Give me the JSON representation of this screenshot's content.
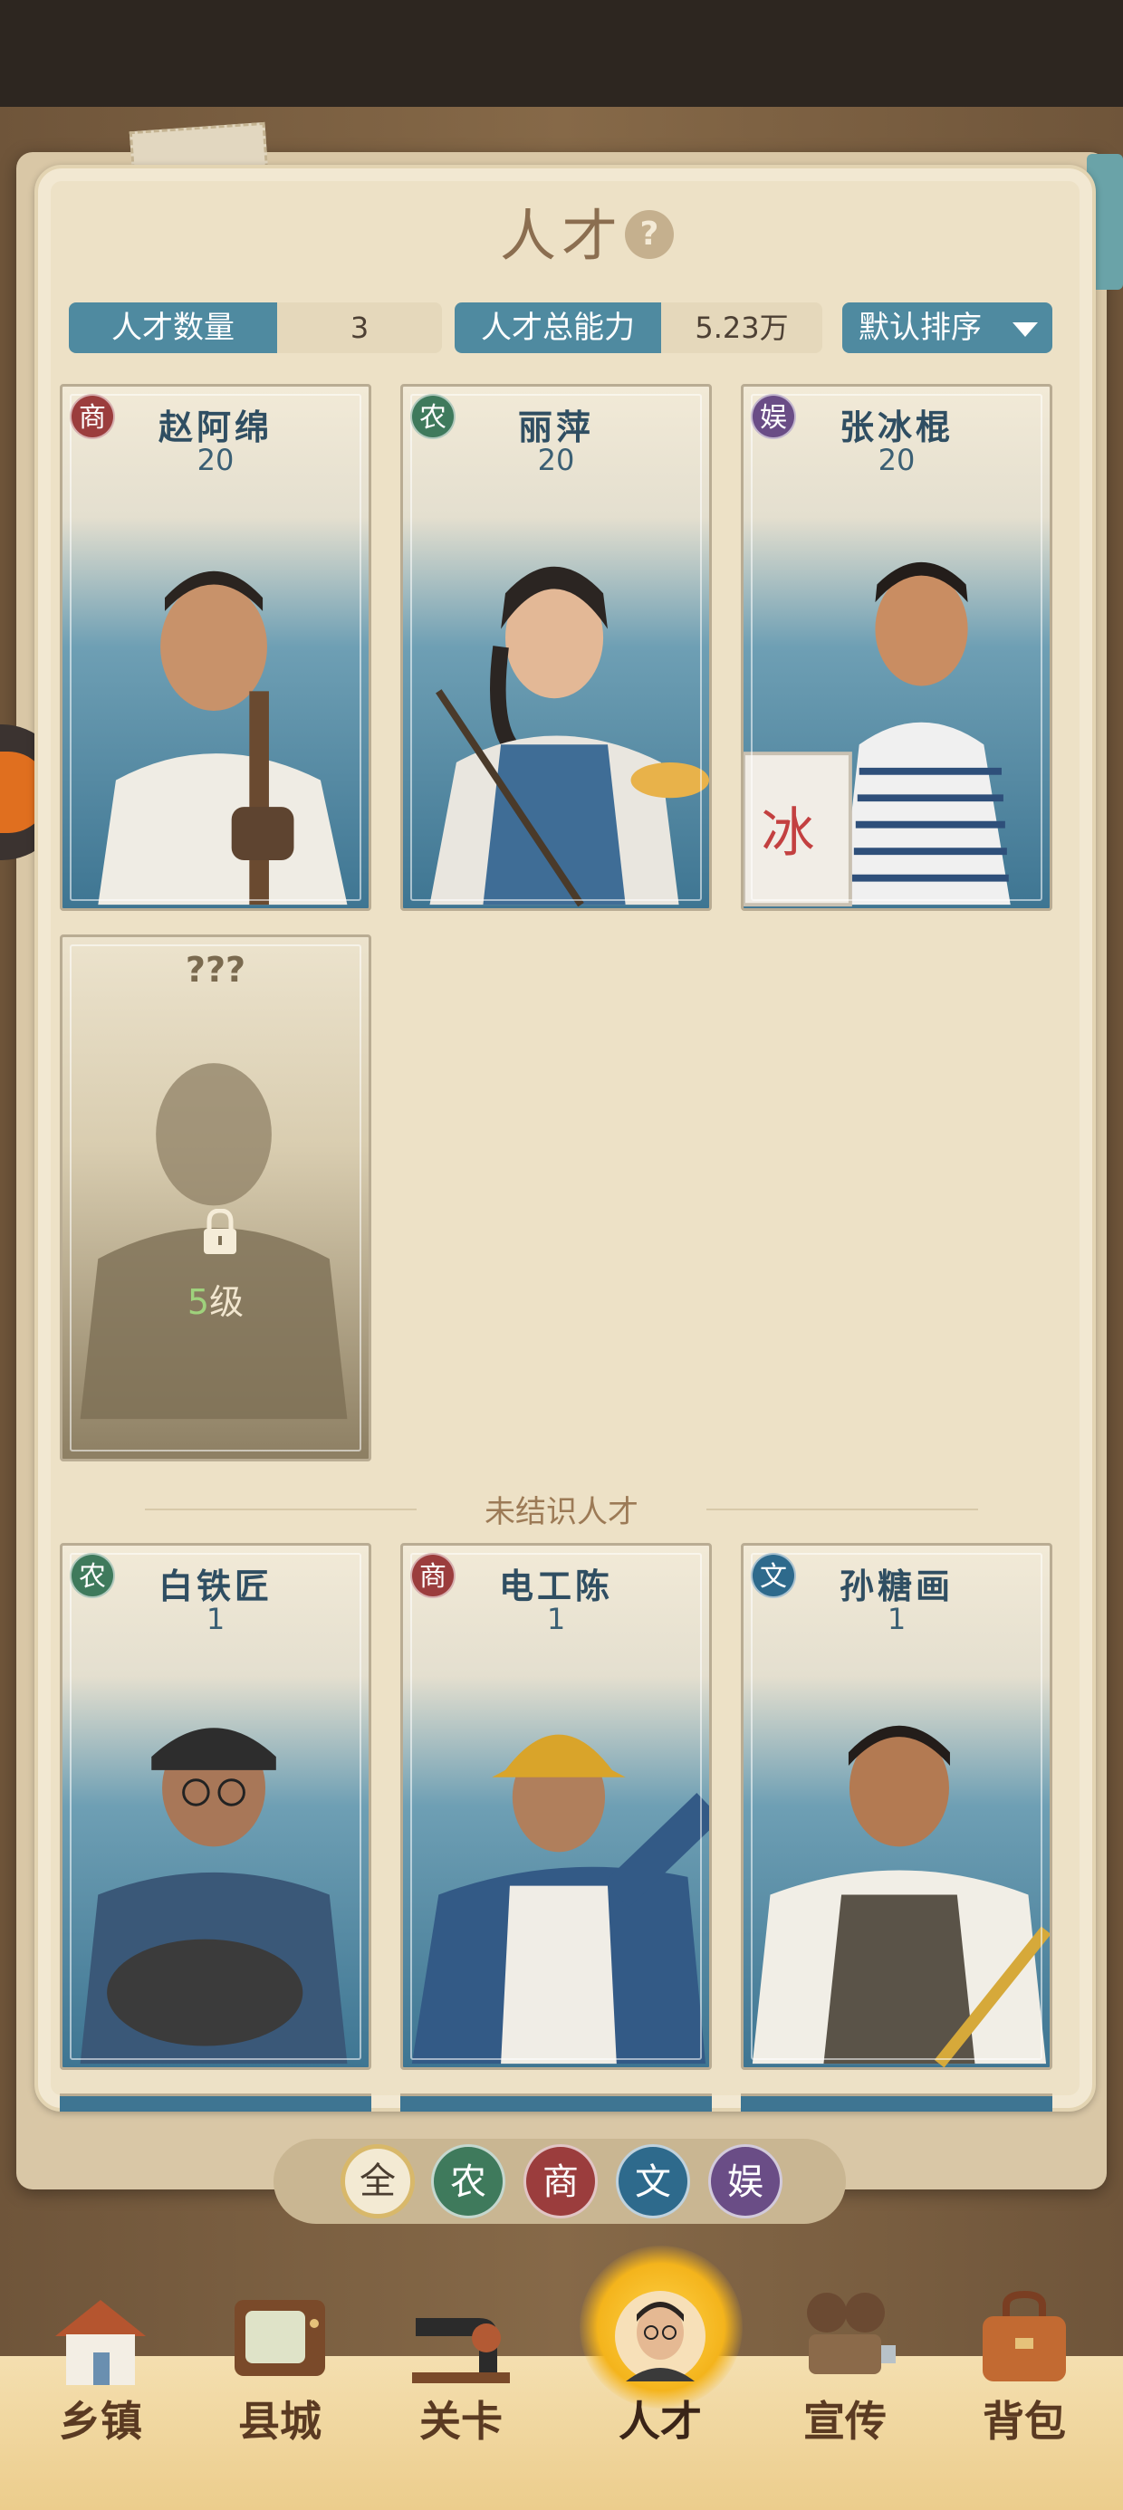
{
  "header": {
    "title": "人才",
    "help_glyph": "?"
  },
  "stats": {
    "count_label": "人才数量",
    "count_value": "3",
    "power_label": "人才总能力",
    "power_value": "5.23万",
    "sort_label": "默认排序"
  },
  "known_talents": [
    {
      "name": "赵阿绵",
      "level": "20",
      "category": "商",
      "category_color": "#9b3d3d"
    },
    {
      "name": "丽萍",
      "level": "20",
      "category": "农",
      "category_color": "#3f7a5c"
    },
    {
      "name": "张冰棍",
      "level": "20",
      "category": "娱",
      "category_color": "#6a4d86"
    }
  ],
  "locked_card": {
    "name": "???",
    "level_num": "5",
    "level_suffix": "级"
  },
  "divider": "未结识人才",
  "unknown_talents": [
    {
      "name": "白铁匠",
      "level": "1",
      "category": "农"
    },
    {
      "name": "电工陈",
      "level": "1",
      "category": "商"
    },
    {
      "name": "孙糖画",
      "level": "1",
      "category": "文"
    }
  ],
  "filters": [
    "全",
    "农",
    "商",
    "文",
    "娱"
  ],
  "nav": [
    {
      "label": "乡镇",
      "icon": "house-icon"
    },
    {
      "label": "县城",
      "icon": "tv-icon"
    },
    {
      "label": "关卡",
      "icon": "sewing-machine-icon"
    },
    {
      "label": "人才",
      "icon": "person-portrait-icon",
      "active": true
    },
    {
      "label": "宣传",
      "icon": "film-projector-icon"
    },
    {
      "label": "背包",
      "icon": "bag-icon"
    }
  ],
  "colors": {
    "accent_blue": "#4f8aa0",
    "paper": "#ede1c6",
    "nav_bg": "#eccd8c",
    "active_glow": "#f4b41c"
  }
}
